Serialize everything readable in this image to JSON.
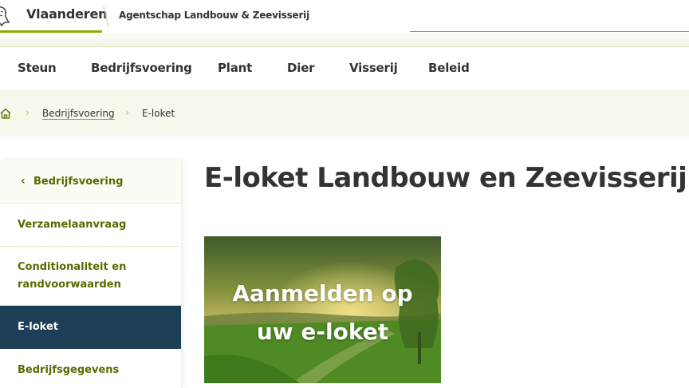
{
  "header": {
    "brand": "Vlaanderen",
    "agency": "Agentschap Landbouw & Zeevisserij"
  },
  "nav": {
    "items": [
      "Steun",
      "Bedrijfsvoering",
      "Plant",
      "Dier",
      "Visserij",
      "Beleid"
    ]
  },
  "breadcrumb": {
    "items": [
      {
        "label": "Bedrijfsvoering"
      },
      {
        "label": "E-loket"
      }
    ]
  },
  "sidebar": {
    "back_label": "Bedrijfsvoering",
    "items": [
      {
        "label": "Verzamelaanvraag"
      },
      {
        "label_line1": "Conditionaliteit en",
        "label_line2": "randvoorwaarden"
      },
      {
        "label": "E-loket"
      },
      {
        "label": "Bedrijfsgegevens"
      }
    ],
    "active_index": 2
  },
  "main": {
    "title": "E-loket Landbouw en Zeevisserij",
    "hero": {
      "line1": "Aanmelden op",
      "line2": "uw e-loket"
    }
  },
  "colors": {
    "accent_green": "#8bae00",
    "link_green": "#556b00",
    "active_bg": "#1c3f57",
    "crumb_bg": "#f6f8ec"
  },
  "icons": {
    "logo": "lion-icon",
    "home": "home-icon",
    "crumb_separator": "chevron-right-icon",
    "back": "chevron-left-icon"
  }
}
